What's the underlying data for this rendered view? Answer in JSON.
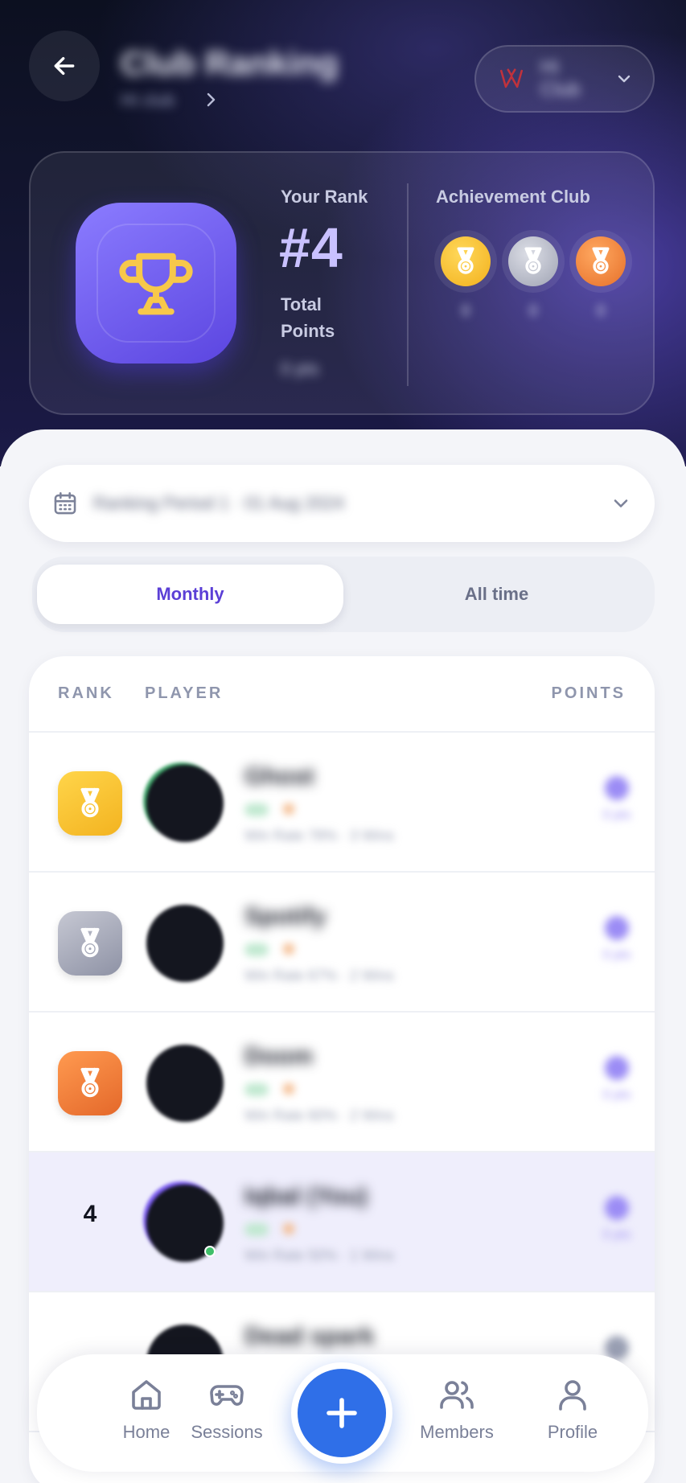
{
  "header": {
    "title": "Club Ranking",
    "subtitle": "Hi club",
    "club_select": {
      "name": "Hi Club"
    }
  },
  "rank_card": {
    "rank_label": "Your Rank",
    "rank_value": "#4",
    "points_label": "Total Points",
    "points_value": "0 pts",
    "achievement_label": "Achievement Club",
    "medals": [
      {
        "tier": "gold",
        "count": "0",
        "color": "#f5c02e"
      },
      {
        "tier": "silver",
        "count": "0",
        "color": "#b9bcc8"
      },
      {
        "tier": "bronze",
        "count": "0",
        "color": "#f08a3c"
      }
    ]
  },
  "period_select": {
    "value": "Ranking Period 1 · 01 Aug 2024"
  },
  "tabs": [
    {
      "label": "Monthly",
      "active": true
    },
    {
      "label": "All time",
      "active": false
    }
  ],
  "table": {
    "headers": {
      "rank": "RANK",
      "player": "PLAYER",
      "points": "POINTS"
    },
    "rows": [
      {
        "rank": "1",
        "badge": "gold",
        "name": "Ghost",
        "meta": "Win Rate 78% · 3 Wins",
        "points": "0 pts"
      },
      {
        "rank": "2",
        "badge": "silver",
        "name": "Spotify",
        "meta": "Win Rate 67% · 2 Wins",
        "points": "0 pts"
      },
      {
        "rank": "3",
        "badge": "bronze",
        "name": "Doom",
        "meta": "Win Rate 60% · 2 Wins",
        "points": "0 pts"
      },
      {
        "rank": "4",
        "badge": "",
        "name": "Iqbal (You)",
        "meta": "Win Rate 50% · 1 Wins",
        "points": "0 pts",
        "is_me": true
      },
      {
        "rank": "5",
        "badge": "",
        "name": "Dead spark",
        "meta": "",
        "points": ""
      }
    ]
  },
  "nav": {
    "items": [
      {
        "label": "Home",
        "icon": "home-icon"
      },
      {
        "label": "Sessions",
        "icon": "gamepad-icon"
      },
      {
        "label": "Members",
        "icon": "members-icon"
      },
      {
        "label": "Profile",
        "icon": "profile-icon"
      }
    ],
    "fab_icon": "plus-icon"
  },
  "colors": {
    "accent": "#5b3fd6",
    "fab": "#2f6fe8",
    "gold": "#f5c02e",
    "silver": "#a8abb9",
    "bronze": "#f08a3c"
  }
}
